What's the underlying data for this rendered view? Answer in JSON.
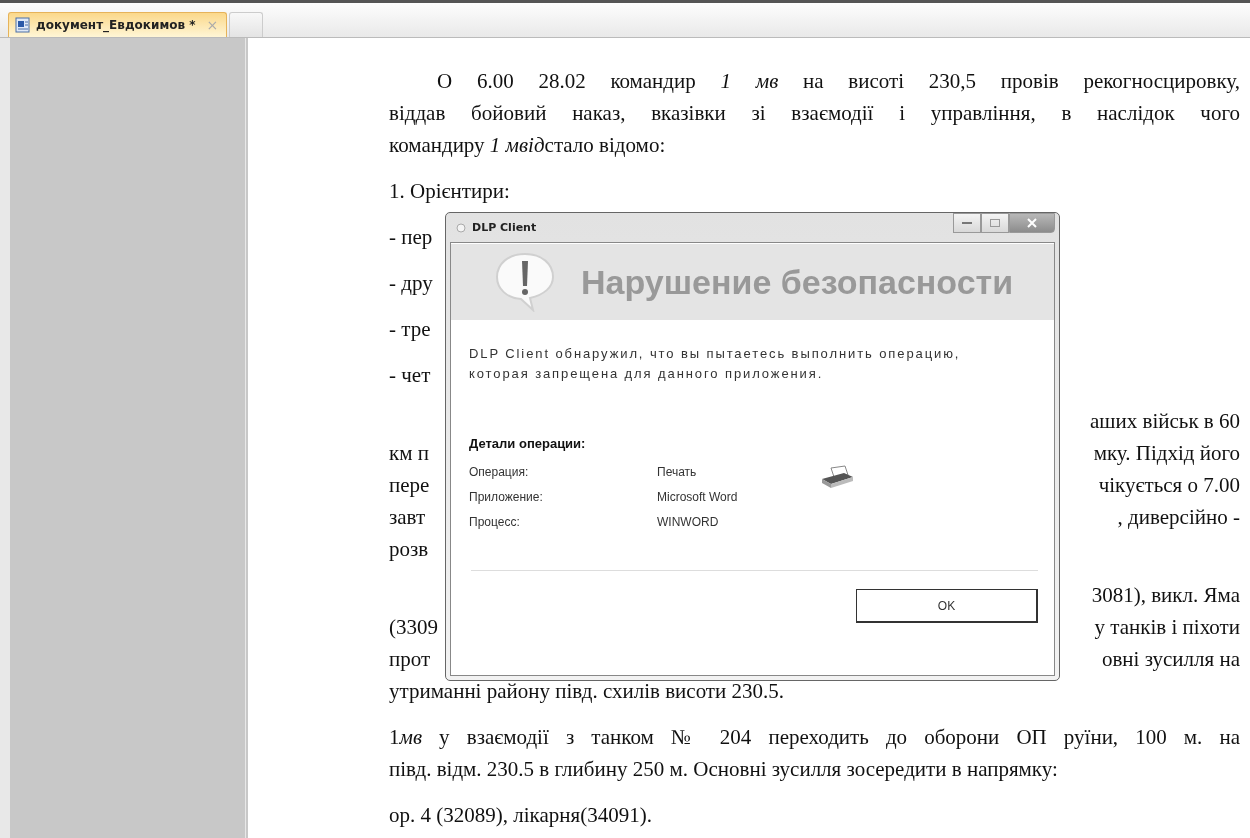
{
  "tabs": [
    {
      "label": "документ_Евдокимов *",
      "close": "×",
      "selected": true
    }
  ],
  "document": {
    "paragraphs": [
      {
        "indent": true,
        "lines": [
          {
            "parts": [
              {
                "text": "О 6.00 28.02 командир ",
                "italic": false
              },
              {
                "text": "1 мв",
                "italic": true
              },
              {
                "text": " на висоті 230,5 провів рекогносцировку,",
                "italic": false
              }
            ]
          },
          {
            "text": "віддав бойовий наказ, вказівки зі взаємодії і управління, в наслідок чого"
          },
          {
            "parts": [
              {
                "text": "командиру ",
                "italic": false
              },
              {
                "text": "1 мвід",
                "italic": true
              },
              {
                "text": "стало відомо:",
                "italic": false
              }
            ]
          }
        ]
      },
      {
        "indent": false,
        "lines": [
          {
            "text": "1. Орієнтири:"
          }
        ]
      },
      {
        "indent": false,
        "lines": [
          {
            "left": "- пер"
          }
        ]
      },
      {
        "indent": false,
        "lines": [
          {
            "left": "- дру"
          }
        ]
      },
      {
        "indent": false,
        "lines": [
          {
            "left": "- тре"
          }
        ]
      },
      {
        "indent": false,
        "lines": [
          {
            "left": "- чет"
          }
        ]
      },
      {
        "lines": [
          {
            "right": "аших військ в 60"
          },
          {
            "left": "км п",
            "right": "мку. Підхід його"
          },
          {
            "left": "пере",
            "right": "чікується о 7.00"
          },
          {
            "left": "завт",
            "right": ", диверсійно -"
          },
          {
            "left": "розв"
          }
        ]
      },
      {
        "lines": [
          {
            "right": "3081), викл. Яма"
          },
          {
            "left": "(3309",
            "right": "у танків і піхоти"
          },
          {
            "left": "прот",
            "right": "овні зусилля на"
          },
          {
            "text": "утриманні району півд. схилів висоти 230.5."
          }
        ]
      },
      {
        "indent": false,
        "lines": [
          {
            "parts": [
              {
                "text": "1",
                "italic": false
              },
              {
                "text": "мв",
                "italic": true
              },
              {
                "text": " у взаємодії з танком № 204 переходить до оборони ОП руїни, 100 м. на",
                "italic": false
              }
            ]
          },
          {
            "text": "півд. відм. 230.5 в глибину 250 м. Основні зусилля зосередити в напрямку:"
          }
        ]
      },
      {
        "indent": false,
        "lines": [
          {
            "text": "ор. 4 (32089), лікарня(34091)."
          }
        ]
      }
    ]
  },
  "dialog": {
    "title": "DLP Client",
    "heading": "Нарушение безопасности",
    "message": "DLP Client обнаружил, что вы пытаетесь выполнить операцию, которая запрещена для данного приложения.",
    "details_title": "Детали операции:",
    "details": [
      {
        "label": "Операция:",
        "value": "Печать"
      },
      {
        "label": "Приложение:",
        "value": "Microsoft Word"
      },
      {
        "label": "Процесс:",
        "value": "WINWORD"
      }
    ],
    "button": "OK"
  }
}
